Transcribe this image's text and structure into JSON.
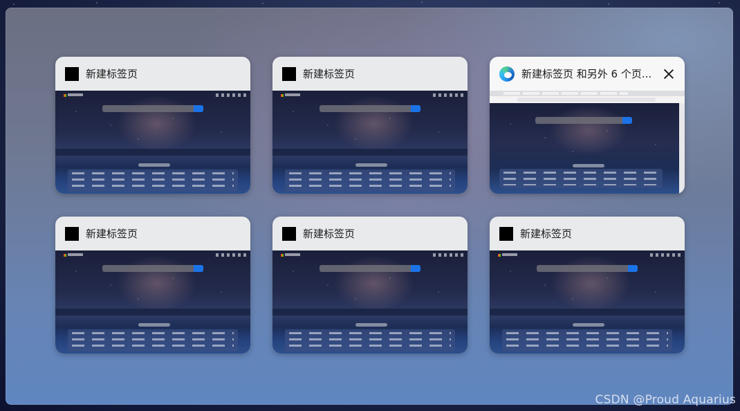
{
  "window_cards": [
    {
      "title": "新建标签页",
      "active": false
    },
    {
      "title": "新建标签页",
      "active": false
    },
    {
      "title": "新建标签页 和另外 6 个页...",
      "active": true,
      "icon": "edge-browser-icon"
    },
    {
      "title": "新建标签页",
      "active": false
    },
    {
      "title": "新建标签页",
      "active": false
    },
    {
      "title": "新建标签页",
      "active": false
    }
  ],
  "watermark": "CSDN @Proud Aquarius"
}
